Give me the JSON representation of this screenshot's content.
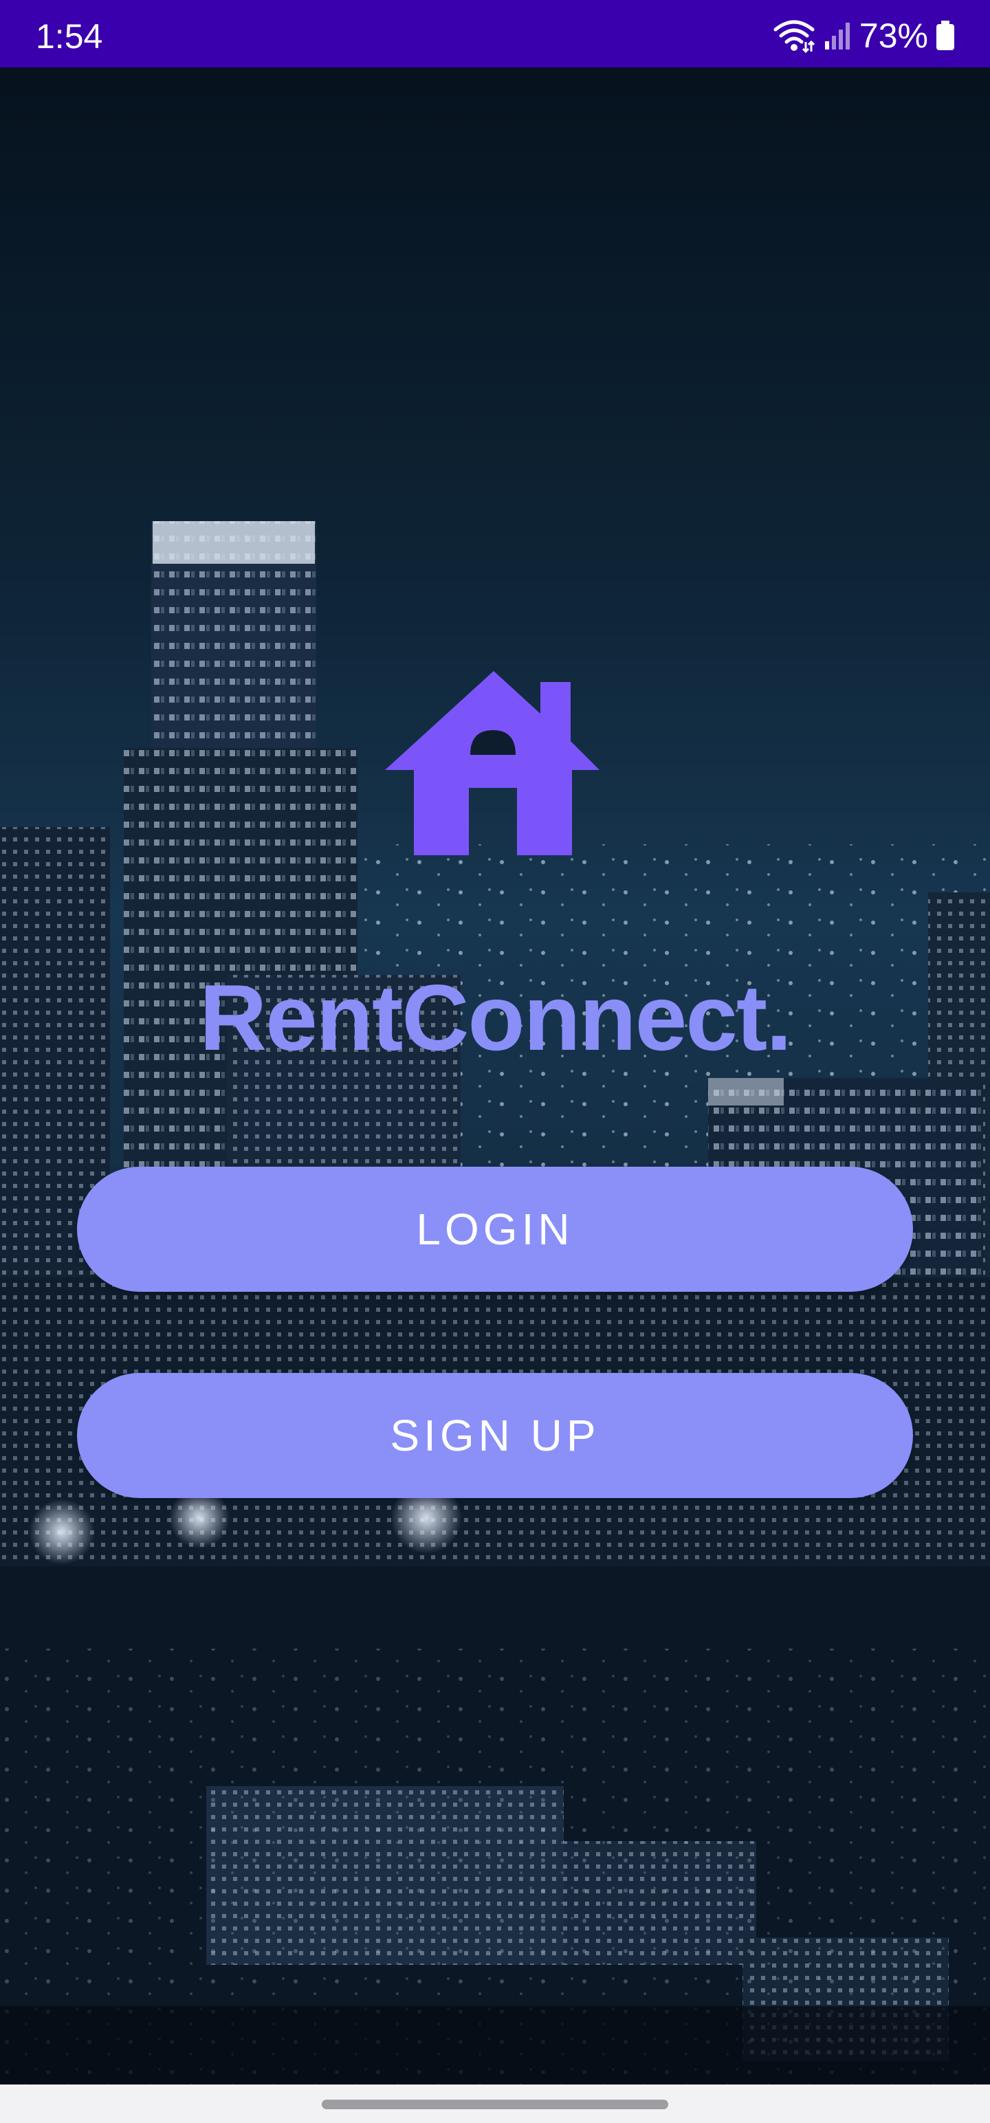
{
  "status_bar": {
    "time": "1:54",
    "battery_percent": "73%",
    "wifi_icon": "wifi-icon",
    "signal_icon": "cell-signal-icon",
    "battery_icon": "battery-icon",
    "background_color": "#3a00ad"
  },
  "app": {
    "logo_icon": "house-icon",
    "brand_name": "RentConnect.",
    "brand_color": "#8a8ff7",
    "accent_color": "#7b55fa"
  },
  "actions": {
    "login_label": "LOGIN",
    "signup_label": "SIGN UP",
    "button_color": "#8a90f8"
  },
  "navigation": {
    "home_handle_icon": "gesture-handle-icon"
  }
}
